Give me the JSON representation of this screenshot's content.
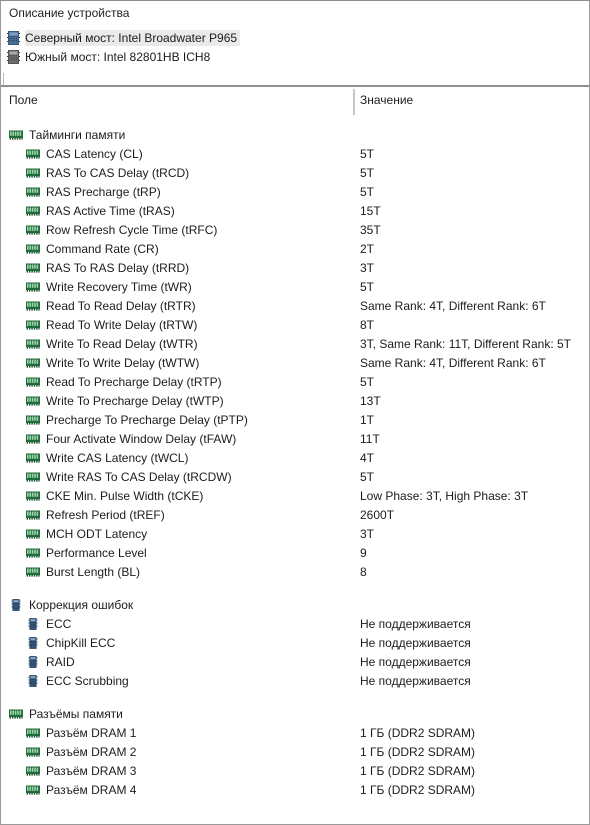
{
  "panel": {
    "device_section_title": "Описание устройства",
    "devices": [
      {
        "label": "Северный мост: Intel Broadwater P965",
        "icon": "chip-icon-blue",
        "selected": true
      },
      {
        "label": "Южный мост: Intel 82801HB ICH8",
        "icon": "chip-icon-gray",
        "selected": false
      }
    ],
    "columns": {
      "field": "Поле",
      "value": "Значение"
    },
    "colors": {
      "ram_icon_green": "#1f6b3a",
      "chip_icon_blue": "#4a6f95",
      "chip_icon_gray": "#6e6e6e",
      "selection_bg": "#eaeaea",
      "divider": "#8e8e8e",
      "text": "#1c1c1c"
    },
    "groups": [
      {
        "title": "Тайминги памяти",
        "icon": "ram-icon",
        "rows": [
          {
            "label": "CAS Latency (CL)",
            "value": "5T"
          },
          {
            "label": "RAS To CAS Delay (tRCD)",
            "value": "5T"
          },
          {
            "label": "RAS Precharge (tRP)",
            "value": "5T"
          },
          {
            "label": "RAS Active Time (tRAS)",
            "value": "15T"
          },
          {
            "label": "Row Refresh Cycle Time (tRFC)",
            "value": "35T"
          },
          {
            "label": "Command Rate (CR)",
            "value": "2T"
          },
          {
            "label": "RAS To RAS Delay (tRRD)",
            "value": "3T"
          },
          {
            "label": "Write Recovery Time (tWR)",
            "value": "5T"
          },
          {
            "label": "Read To Read Delay (tRTR)",
            "value": "Same Rank: 4T, Different Rank: 6T"
          },
          {
            "label": "Read To Write Delay (tRTW)",
            "value": "8T"
          },
          {
            "label": "Write To Read Delay (tWTR)",
            "value": "3T, Same Rank: 11T, Different Rank: 5T"
          },
          {
            "label": "Write To Write Delay (tWTW)",
            "value": "Same Rank: 4T, Different Rank: 6T"
          },
          {
            "label": "Read To Precharge Delay (tRTP)",
            "value": "5T"
          },
          {
            "label": "Write To Precharge Delay (tWTP)",
            "value": "13T"
          },
          {
            "label": "Precharge To Precharge Delay (tPTP)",
            "value": "1T"
          },
          {
            "label": "Four Activate Window Delay (tFAW)",
            "value": "11T"
          },
          {
            "label": "Write CAS Latency (tWCL)",
            "value": "4T"
          },
          {
            "label": "Write RAS To CAS Delay (tRCDW)",
            "value": "5T"
          },
          {
            "label": "CKE Min. Pulse Width (tCKE)",
            "value": "Low Phase: 3T, High Phase: 3T"
          },
          {
            "label": "Refresh Period (tREF)",
            "value": "2600T"
          },
          {
            "label": "MCH ODT Latency",
            "value": "3T"
          },
          {
            "label": "Performance Level",
            "value": "9"
          },
          {
            "label": "Burst Length (BL)",
            "value": "8"
          }
        ]
      },
      {
        "title": "Коррекция ошибок",
        "icon": "vchip-icon",
        "rows": [
          {
            "label": "ECC",
            "value": "Не поддерживается"
          },
          {
            "label": "ChipKill ECC",
            "value": "Не поддерживается"
          },
          {
            "label": "RAID",
            "value": "Не поддерживается"
          },
          {
            "label": "ECC Scrubbing",
            "value": "Не поддерживается"
          }
        ]
      },
      {
        "title": "Разъёмы памяти",
        "icon": "ram-icon",
        "rows": [
          {
            "label": "Разъём DRAM 1",
            "value": "1 ГБ  (DDR2 SDRAM)"
          },
          {
            "label": "Разъём DRAM 2",
            "value": "1 ГБ  (DDR2 SDRAM)"
          },
          {
            "label": "Разъём DRAM 3",
            "value": "1 ГБ  (DDR2 SDRAM)"
          },
          {
            "label": "Разъём DRAM 4",
            "value": "1 ГБ  (DDR2 SDRAM)"
          }
        ]
      }
    ]
  }
}
